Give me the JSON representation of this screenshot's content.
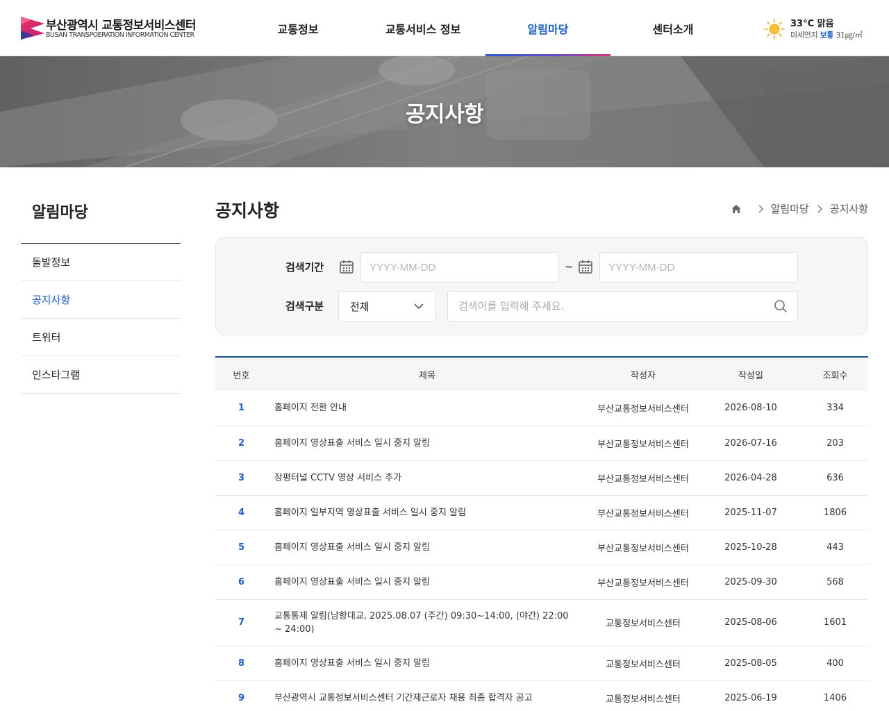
{
  "header": {
    "logo_title": "부산광역시 교통정보서비스센터",
    "logo_subtitle": "BUSAN TRANSPOERATION INFORMATION CENTER",
    "nav": [
      {
        "label": "교통정보"
      },
      {
        "label": "교통서비스 정보"
      },
      {
        "label": "알림마당",
        "active": true
      },
      {
        "label": "센터소개"
      }
    ],
    "weather": {
      "temp": "33°C 맑음",
      "dust_label": "미세먼지",
      "dust_status": "보통",
      "dust_value": "31㎍/㎥",
      "icon": "sun-icon"
    }
  },
  "hero": {
    "title": "공지사항"
  },
  "sidebar": {
    "title": "알림마당",
    "items": [
      {
        "label": "돌발정보"
      },
      {
        "label": "공지사항",
        "active": true
      },
      {
        "label": "트위터"
      },
      {
        "label": "인스타그램"
      }
    ]
  },
  "content": {
    "title": "공지사항",
    "breadcrumb": [
      "알림마당",
      "공지사항"
    ]
  },
  "search": {
    "period_label": "검색기간",
    "date_placeholder": "YYYY-MM-DD",
    "tilde": "~",
    "type_label": "검색구분",
    "type_selected": "전체",
    "keyword_placeholder": "검색어를 입력해 주세요."
  },
  "table": {
    "headers": [
      "번호",
      "제목",
      "작성자",
      "작성일",
      "조회수"
    ],
    "rows": [
      {
        "no": "1",
        "title": "홈페이지 전환 안내",
        "author": "부산교통정보서비스센터",
        "date": "2026-08-10",
        "views": "334"
      },
      {
        "no": "2",
        "title": "홈페이지 영상표출 서비스 일시 중지 알림",
        "author": "부산교통정보서비스센터",
        "date": "2026-07-16",
        "views": "203"
      },
      {
        "no": "3",
        "title": "장평터널 CCTV 영상 서비스 추가",
        "author": "부산교통정보서비스센터",
        "date": "2026-04-28",
        "views": "636"
      },
      {
        "no": "4",
        "title": "홈페이지 일부지역 영상표출 서비스 일시 중지 알림",
        "author": "부산교통정보서비스센터",
        "date": "2025-11-07",
        "views": "1806"
      },
      {
        "no": "5",
        "title": "홈페이지 영상표출 서비스 일시 중지 알림",
        "author": "부산교통정보서비스센터",
        "date": "2025-10-28",
        "views": "443"
      },
      {
        "no": "6",
        "title": "홈페이지 영상표출 서비스 일시 중지 알림",
        "author": "부산교통정보서비스센터",
        "date": "2025-09-30",
        "views": "568"
      },
      {
        "no": "7",
        "title": "교통통제 알림(남항대교, 2025.08.07 (주간) 09:30~14:00, (야간) 22:00 ~ 24:00)",
        "author": "교통정보서비스센터",
        "date": "2025-08-06",
        "views": "1601"
      },
      {
        "no": "8",
        "title": "홈페이지 영상표출 서비스 일시 중지 알림",
        "author": "교통정보서비스센터",
        "date": "2025-08-05",
        "views": "400"
      },
      {
        "no": "9",
        "title": "부산광역시 교통정보서비스센터 기간제근로자 채용 최종 합격자 공고",
        "author": "교통정보서비스센터",
        "date": "2025-06-19",
        "views": "1406"
      }
    ]
  },
  "colors": {
    "accent": "#1d5fc4",
    "table_top_border": "#1b4f8f",
    "search_bg": "#f5f6f8"
  }
}
